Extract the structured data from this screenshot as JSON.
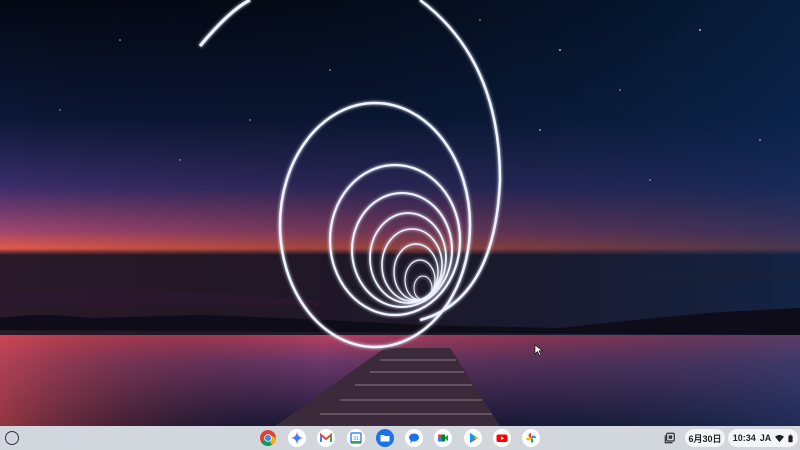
{
  "shelf": {
    "apps": [
      {
        "name": "Chrome",
        "icon": "chrome-icon"
      },
      {
        "name": "Gemini",
        "icon": "gemini-icon"
      },
      {
        "name": "Gmail",
        "icon": "gmail-icon"
      },
      {
        "name": "Google Calendar",
        "icon": "calendar-icon",
        "label": "31"
      },
      {
        "name": "Files",
        "icon": "files-icon"
      },
      {
        "name": "Messages",
        "icon": "messages-icon"
      },
      {
        "name": "Google Meet",
        "icon": "meet-icon"
      },
      {
        "name": "Play Store",
        "icon": "play-store-icon"
      },
      {
        "name": "YouTube",
        "icon": "youtube-icon"
      },
      {
        "name": "Google Photos",
        "icon": "photos-icon"
      }
    ],
    "date": "6月30日",
    "time": "10:34",
    "ime": "JA"
  }
}
